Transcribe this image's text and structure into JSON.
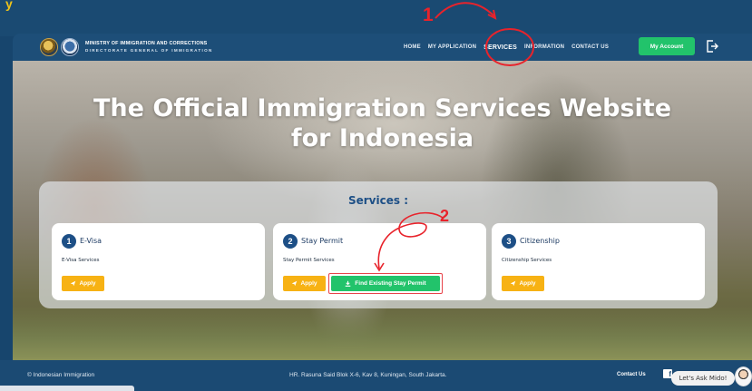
{
  "header": {
    "ministry_line1": "MINISTRY OF IMMIGRATION AND CORRECTIONS",
    "ministry_line2": "DIRECTORATE GENERAL OF IMMIGRATION",
    "nav": [
      {
        "label": "HOME",
        "active": false
      },
      {
        "label": "MY APPLICATION",
        "active": false
      },
      {
        "label": "SERVICES",
        "active": true
      },
      {
        "label": "INFORMATION",
        "active": false
      },
      {
        "label": "CONTACT US",
        "active": false
      }
    ],
    "account_button": "My Account",
    "logout_icon": "logout-icon"
  },
  "hero": {
    "title_line1": "The Official Immigration Services Website",
    "title_line2": "for Indonesia"
  },
  "services": {
    "heading": "Services :",
    "cards": [
      {
        "number": "1",
        "title": "E-Visa",
        "subtitle": "E-Visa Services",
        "apply_label": "Apply"
      },
      {
        "number": "2",
        "title": "Stay Permit",
        "subtitle": "Stay Permit Services",
        "apply_label": "Apply",
        "find_label": "Find Existing Stay Permit"
      },
      {
        "number": "3",
        "title": "Citizenship",
        "subtitle": "Citizenship Services",
        "apply_label": "Apply"
      }
    ]
  },
  "annotations": {
    "step1": "1",
    "step2": "2",
    "color": "#e8232b"
  },
  "footer": {
    "copyright": "© Indonesian Immigration",
    "address": "HR. Rasuna Said Blok X-6, Kav 8, Kuningan, South Jakarta.",
    "contact": "Contact Us",
    "chat_bubble": "Let's Ask Mido!"
  },
  "colors": {
    "primary": "#1d4f86",
    "green": "#22c36b",
    "yellow": "#f7b214",
    "accent_top": "#f0c419"
  }
}
